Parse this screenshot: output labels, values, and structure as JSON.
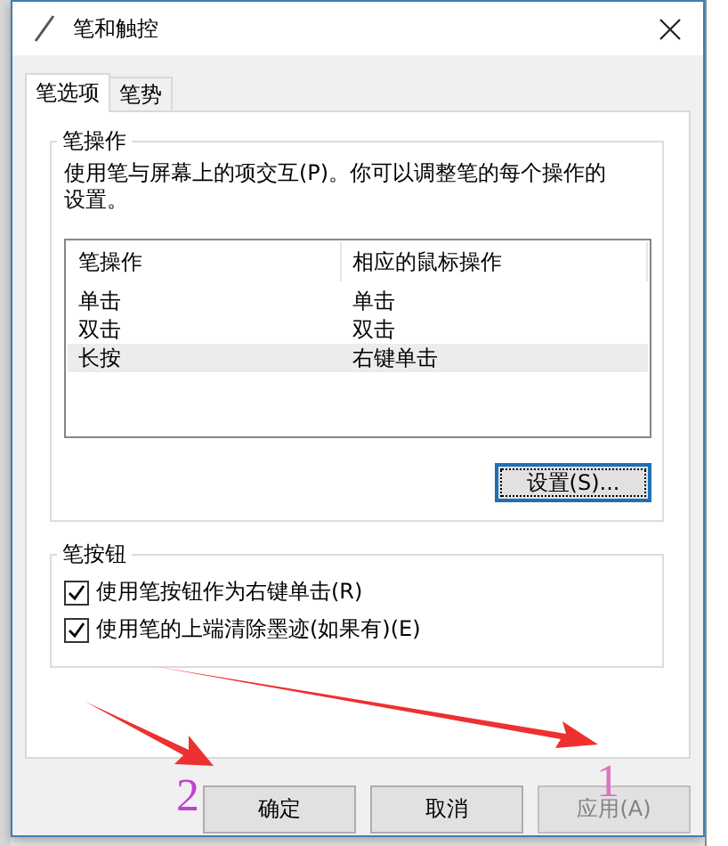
{
  "window": {
    "title": "笔和触控"
  },
  "tabs": [
    {
      "label": "笔选项",
      "selected": true
    },
    {
      "label": "笔势",
      "selected": false
    }
  ],
  "pen_actions": {
    "title": "笔操作",
    "description": "使用笔与屏幕上的项交互(P)。你可以调整笔的每个操作的设置。",
    "columns": [
      "笔操作",
      "相应的鼠标操作"
    ],
    "rows": [
      {
        "cells": [
          "单击",
          "单击"
        ],
        "selected": false
      },
      {
        "cells": [
          "双击",
          "双击"
        ],
        "selected": false
      },
      {
        "cells": [
          "长按",
          "右键单击"
        ],
        "selected": true
      }
    ],
    "settings_button": "设置(S)..."
  },
  "pen_button": {
    "title": "笔按钮",
    "options": [
      {
        "label": "使用笔按钮作为右键单击(R)",
        "checked": true
      },
      {
        "label": "使用笔的上端清除墨迹(如果有)(E)",
        "checked": true
      }
    ]
  },
  "buttons": [
    {
      "label": "确定",
      "disabled": false
    },
    {
      "label": "取消",
      "disabled": false
    },
    {
      "label": "应用(A)",
      "disabled": true
    }
  ],
  "annotation_numbers": [
    {
      "text": "2",
      "color": "#c040d0"
    },
    {
      "text": "1",
      "color": "#e070c0"
    }
  ]
}
